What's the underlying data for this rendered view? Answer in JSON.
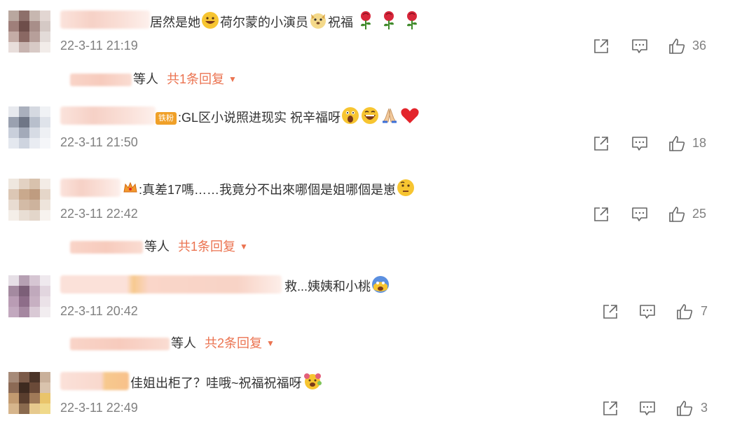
{
  "comments": [
    {
      "text": "居然是她",
      "text_mid": "荷尔蒙的小演员",
      "text_end": "祝福",
      "emojis": [
        "grin-face",
        "dog-face",
        "rose",
        "rose",
        "rose"
      ],
      "time": "22-3-11 21:19",
      "likes": "36",
      "replies": {
        "by": "等人",
        "link": "共1条回复"
      }
    },
    {
      "badge": "铁粉",
      "text": ":GL区小说照进现实 祝辛福呀",
      "emojis": [
        "shocked-face",
        "laugh-face",
        "pray-hands",
        "heart"
      ],
      "time": "22-3-11 21:50",
      "likes": "18"
    },
    {
      "text": ":真差17嗎……我竟分不出來哪個是姐哪個是崽",
      "emojis": [
        "crown",
        "think-face"
      ],
      "time": "22-3-11 22:42",
      "likes": "25",
      "replies": {
        "by": "等人",
        "link": "共1条回复"
      }
    },
    {
      "text": "救...姨姨和小桃",
      "emojis": [
        "scared-face"
      ],
      "time": "22-3-11 20:42",
      "likes": "7",
      "replies": {
        "by": "等人",
        "link": "共2条回复"
      }
    },
    {
      "text": "佳姐出柜了？哇哦~祝福祝福呀",
      "emojis": [
        "flower-face"
      ],
      "time": "22-3-11 22:49",
      "likes": "3"
    }
  ],
  "colors": {
    "accent": "#eb7350",
    "muted": "#808080",
    "text": "#333333",
    "rose": "#d8263a",
    "emoji_yellow": "#f7c531"
  },
  "icons": [
    "share-icon",
    "comment-icon",
    "like-icon",
    "dropdown-arrow-icon"
  ]
}
